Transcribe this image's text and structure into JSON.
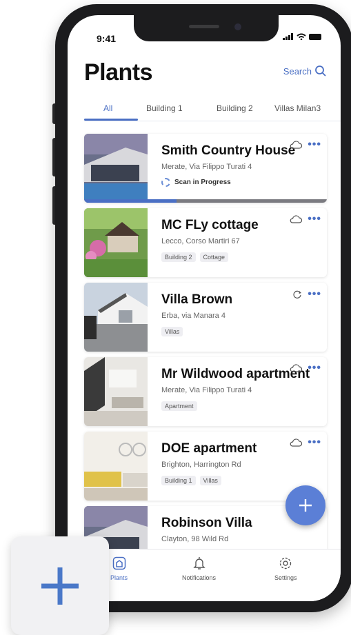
{
  "status_bar": {
    "time": "9:41",
    "signal": "..ıl",
    "wifi": "ᯤ"
  },
  "header": {
    "title": "Plants",
    "search_label": "Search"
  },
  "tabs": [
    {
      "label": "All",
      "active": true
    },
    {
      "label": "Building 1",
      "active": false
    },
    {
      "label": "Building 2",
      "active": false
    },
    {
      "label": "Villas Milan3",
      "active": false
    }
  ],
  "plants": [
    {
      "name": "Smith Country House",
      "address": "Merate, Via Filippo Turati 4",
      "status": "Scan in Progress",
      "scan_progress": 0.38,
      "action_icon": "cloud-icon",
      "tags": []
    },
    {
      "name": "MC FLy cottage",
      "address": "Lecco, Corso Martiri 67",
      "action_icon": "cloud-icon",
      "tags": [
        "Building 2",
        "Cottage"
      ]
    },
    {
      "name": "Villa Brown",
      "address": "Erba, via Manara 4",
      "action_icon": "sync-icon",
      "tags": [
        "Villas"
      ]
    },
    {
      "name": "Mr Wildwood apartment",
      "address": "Merate, Via Filippo Turati 4",
      "action_icon": "cloud-icon",
      "tags": [
        "Apartment"
      ]
    },
    {
      "name": "DOE apartment",
      "address": "Brighton,  Harrington Rd",
      "action_icon": "cloud-icon",
      "tags": [
        "Building 1",
        "Villas"
      ]
    },
    {
      "name": "Robinson Villa",
      "address": "Clayton, 98 Wild Rd",
      "action_icon": "cloud-icon",
      "tags": []
    }
  ],
  "tabbar": [
    {
      "label": "Plants",
      "icon": "home-icon",
      "active": true
    },
    {
      "label": "Notifications",
      "icon": "bell-icon",
      "active": false
    },
    {
      "label": "Settings",
      "icon": "gear-icon",
      "active": false
    }
  ],
  "colors": {
    "accent": "#4a6fc4",
    "fab": "#5b7fd6",
    "progress_track": "#7a7a80"
  }
}
